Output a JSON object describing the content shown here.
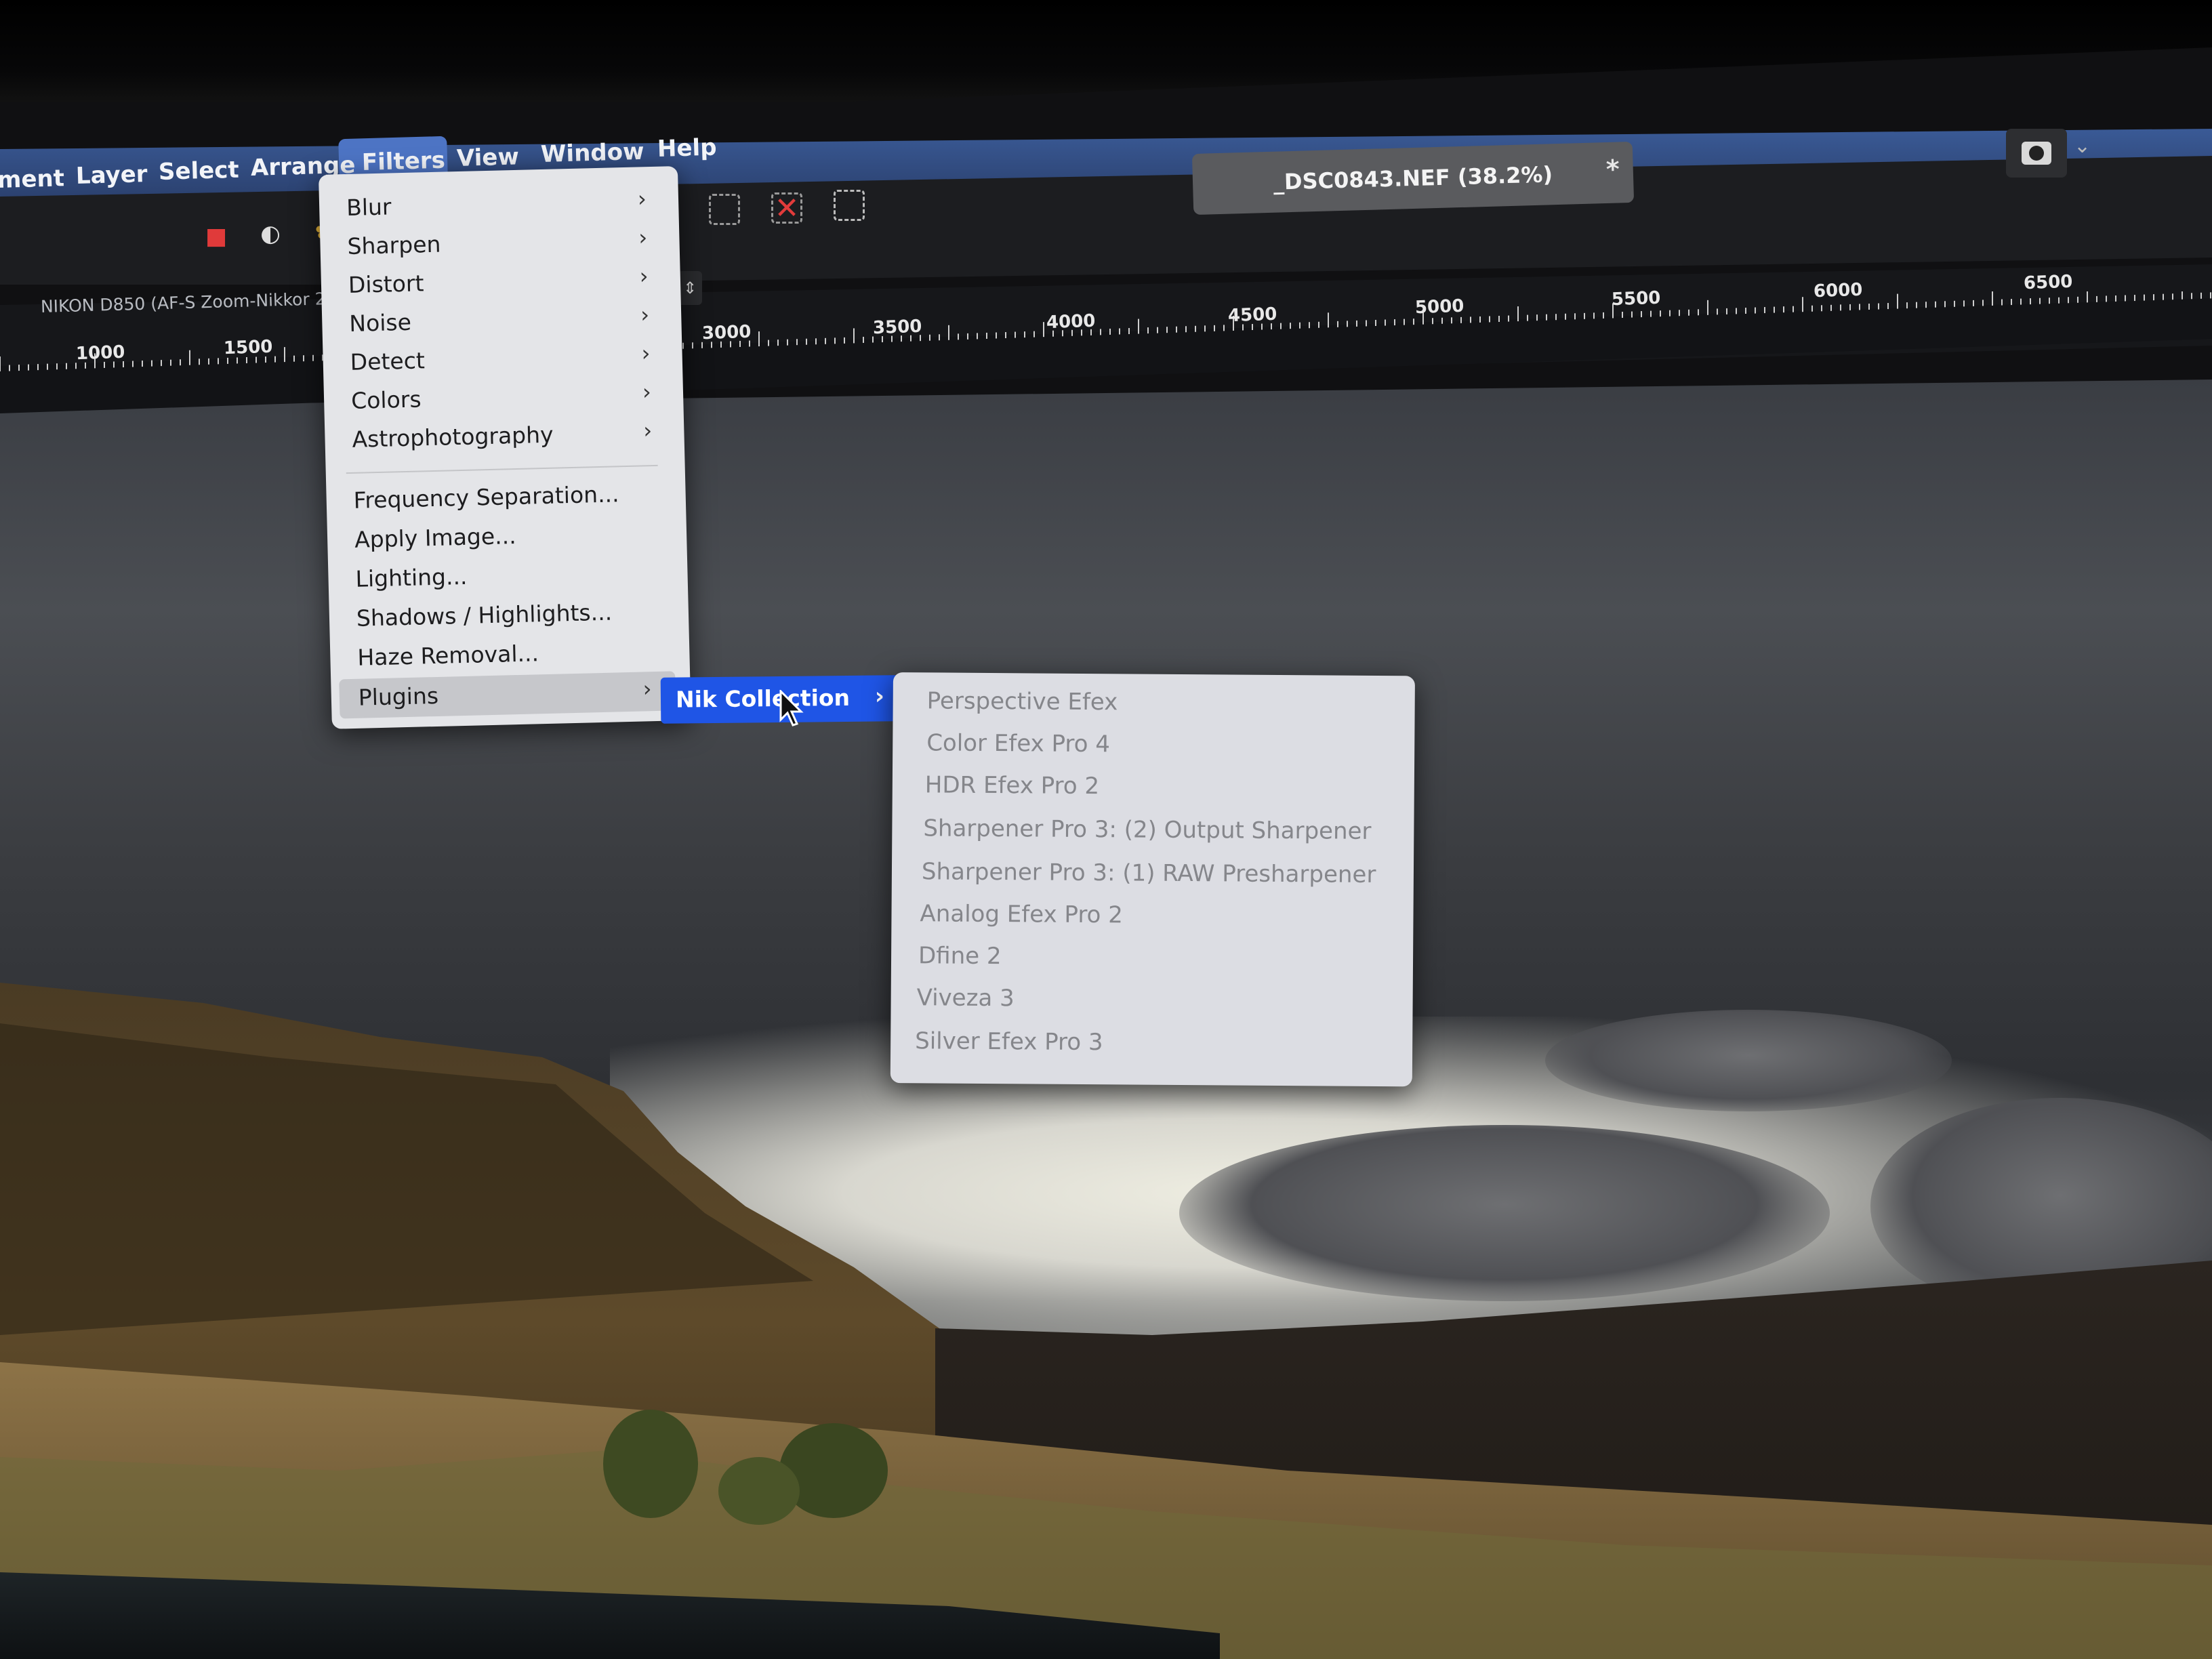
{
  "menubar": {
    "items": [
      {
        "label": "ment"
      },
      {
        "label": "Layer"
      },
      {
        "label": "Select"
      },
      {
        "label": "Arrange"
      },
      {
        "label": "Filters"
      },
      {
        "label": "View"
      },
      {
        "label": "Window"
      },
      {
        "label": "Help"
      }
    ]
  },
  "document": {
    "tab_title": "_DSC0843.NEF (38.2%)",
    "modified_marker": "*"
  },
  "context": {
    "lens_label": "NIKON D850 (AF-S Zoom-Nikkor 24-7"
  },
  "ruler": {
    "labels": [
      "1000",
      "1500",
      "3000",
      "3500",
      "4000",
      "4500",
      "5000",
      "5500",
      "6000",
      "6500"
    ]
  },
  "filters_menu": {
    "submenus": [
      {
        "label": "Blur"
      },
      {
        "label": "Sharpen"
      },
      {
        "label": "Distort"
      },
      {
        "label": "Noise"
      },
      {
        "label": "Detect"
      },
      {
        "label": "Colors"
      },
      {
        "label": "Astrophotography"
      }
    ],
    "actions": [
      {
        "label": "Frequency Separation..."
      },
      {
        "label": "Apply Image..."
      },
      {
        "label": "Lighting..."
      },
      {
        "label": "Shadows / Highlights..."
      },
      {
        "label": "Haze Removal..."
      }
    ],
    "plugins_label": "Plugins"
  },
  "plugins_menu": {
    "nik_label": "Nik Collection"
  },
  "nik_menu": {
    "items": [
      {
        "label": "Perspective Efex"
      },
      {
        "label": "Color Efex Pro 4"
      },
      {
        "label": "HDR Efex Pro 2"
      },
      {
        "label": "Sharpener Pro 3: (2) Output Sharpener"
      },
      {
        "label": "Sharpener Pro 3: (1) RAW Presharpener"
      },
      {
        "label": "Analog Efex Pro 2"
      },
      {
        "label": "Dfine 2"
      },
      {
        "label": "Viveza 3"
      },
      {
        "label": "Silver Efex Pro 3"
      }
    ]
  },
  "colors": {
    "highlight": "#1f55e6",
    "menu_bg": "#e4e5e8",
    "disabled_text": "#85868b"
  }
}
